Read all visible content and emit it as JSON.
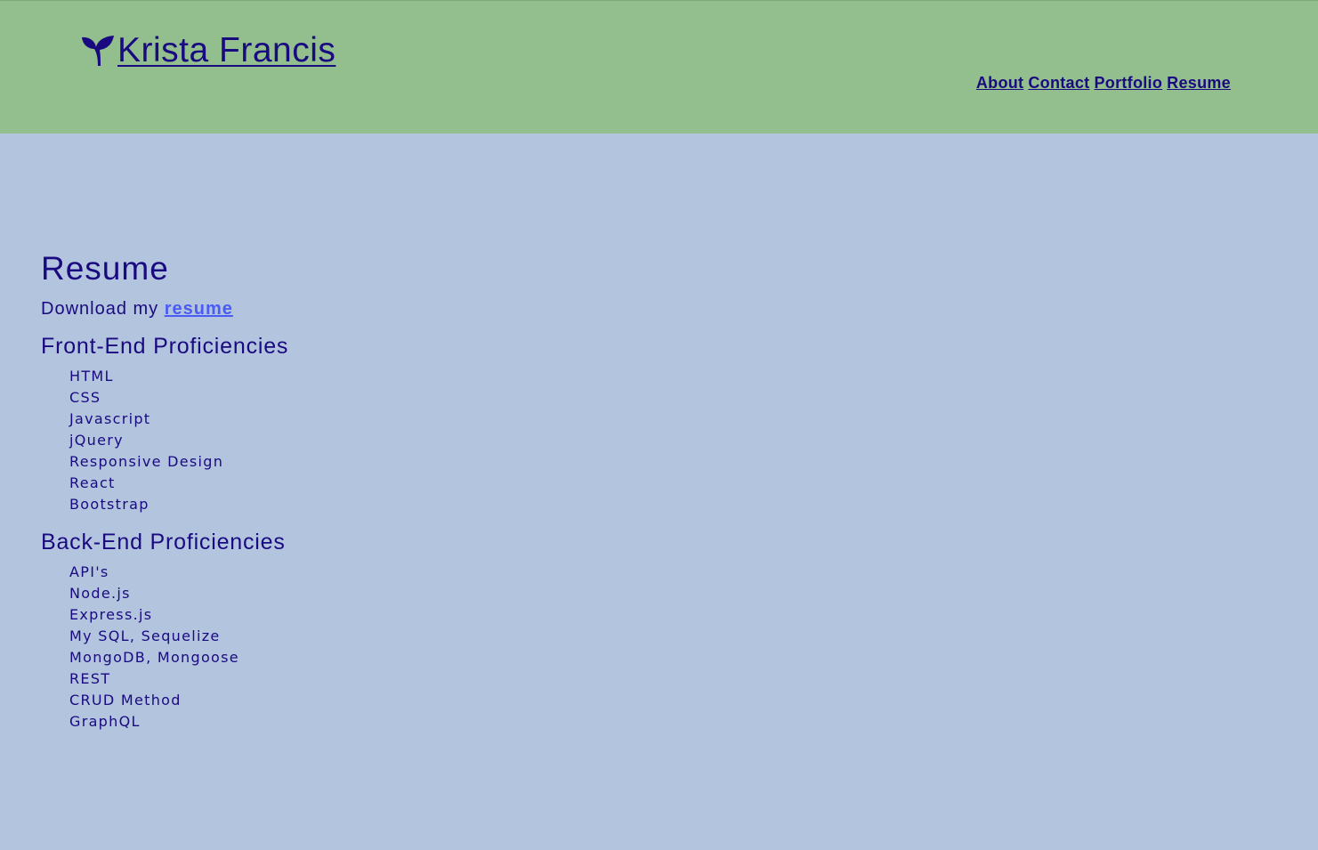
{
  "header": {
    "brand_name": "Krista Francis",
    "logo_icon": "sprout-icon",
    "nav": [
      "About",
      "Contact",
      "Portfolio",
      "Resume"
    ]
  },
  "main": {
    "title": "Resume",
    "download_prefix": "Download my",
    "download_link": "resume",
    "front_end": {
      "heading": "Front-End Proficiencies",
      "items": [
        "HTML",
        "CSS",
        "Javascript",
        "jQuery",
        "Responsive Design",
        "React",
        "Bootstrap"
      ]
    },
    "back_end": {
      "heading": "Back-End Proficiencies",
      "items": [
        "API's",
        "Node.js",
        "Express.js",
        "My SQL, Sequelize",
        "MongoDB, Mongoose",
        "REST",
        "CRUD Method",
        "GraphQL"
      ]
    }
  },
  "colors": {
    "header_bg": "#93bf8f",
    "page_bg": "#b3c4df",
    "text": "#1a0a80",
    "link": "#4a5cf5"
  }
}
